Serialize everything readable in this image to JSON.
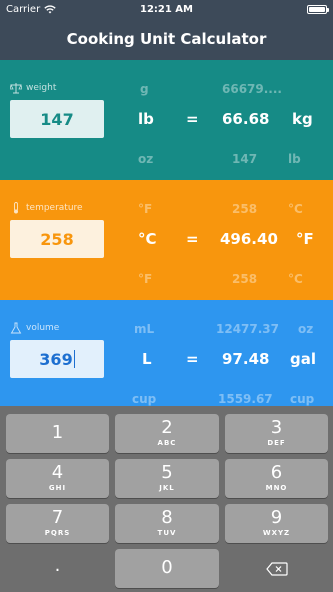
{
  "status": {
    "carrier": "Carrier",
    "time": "12:21 AM"
  },
  "title": "Cooking Unit Calculator",
  "weight": {
    "label": "weight",
    "input": "147",
    "unit": "lb",
    "equals": "=",
    "result": "66.68",
    "result_unit": "kg",
    "ghost_top": {
      "unit": "g",
      "value": "66679....",
      "unit2": ""
    },
    "ghost_bottom": {
      "unit": "oz",
      "value": "147",
      "unit2": "lb"
    }
  },
  "temperature": {
    "label": "temperature",
    "input": "258",
    "unit": "°C",
    "equals": "=",
    "result": "496.40",
    "result_unit": "°F",
    "ghost_top": {
      "unit": "°F",
      "value": "258",
      "unit2": "°C"
    },
    "ghost_bottom": {
      "unit": "°F",
      "value": "258",
      "unit2": "°C"
    }
  },
  "volume": {
    "label": "volume",
    "input": "369",
    "unit": "L",
    "equals": "=",
    "result": "97.48",
    "result_unit": "gal",
    "ghost_top": {
      "unit": "mL",
      "value": "12477.37",
      "unit2": "oz"
    },
    "ghost_bottom": {
      "unit": "cup",
      "value": "1559.67",
      "unit2": "cup"
    }
  },
  "keypad": {
    "k1": {
      "num": "1",
      "letters": ""
    },
    "k2": {
      "num": "2",
      "letters": "ABC"
    },
    "k3": {
      "num": "3",
      "letters": "DEF"
    },
    "k4": {
      "num": "4",
      "letters": "GHI"
    },
    "k5": {
      "num": "5",
      "letters": "JKL"
    },
    "k6": {
      "num": "6",
      "letters": "MNO"
    },
    "k7": {
      "num": "7",
      "letters": "PQRS"
    },
    "k8": {
      "num": "8",
      "letters": "TUV"
    },
    "k9": {
      "num": "9",
      "letters": "WXYZ"
    },
    "k0": {
      "num": "0"
    },
    "dot": "."
  },
  "colors": {
    "weight_bg": "#168b86",
    "temperature_bg": "#f8960d",
    "volume_bg": "#2e96ef",
    "weight_text": "#168b86",
    "temperature_text": "#f8960d",
    "volume_text": "#1d6fd0"
  },
  "icons": {
    "weight": "scale-icon",
    "temperature": "thermometer-icon",
    "volume": "flask-icon",
    "wifi": "wifi-icon",
    "battery": "battery-icon",
    "backspace": "backspace-icon"
  }
}
